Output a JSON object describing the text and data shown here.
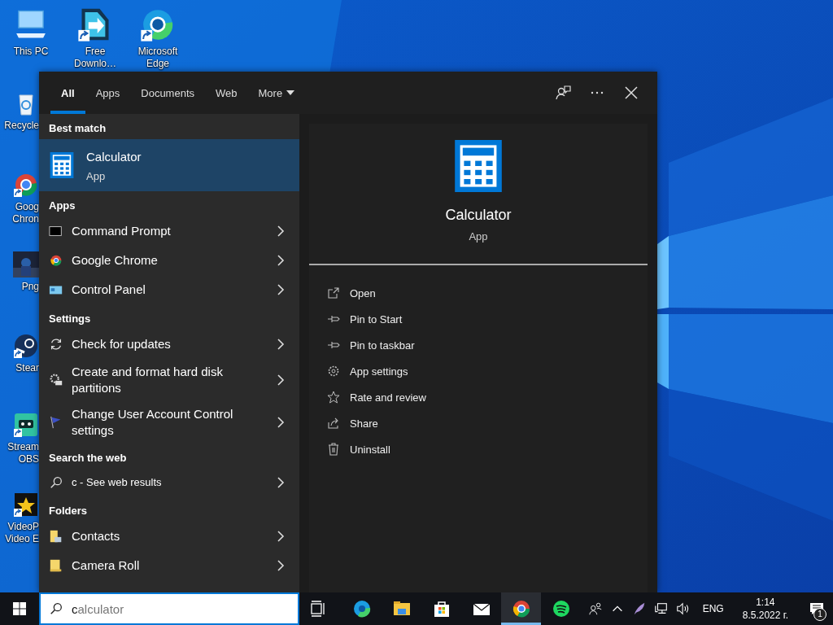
{
  "desktop": {
    "icons": [
      {
        "kind": "pc",
        "label": "This PC",
        "shortcut": false
      },
      {
        "kind": "download",
        "label": "Free Downlo…",
        "shortcut": true
      },
      {
        "kind": "edge",
        "label": "Microsoft Edge",
        "shortcut": true
      },
      {
        "kind": "recycle",
        "label": "Recycle",
        "shortcut": false
      },
      {
        "kind": "chrome",
        "label": "Goog Chron",
        "shortcut": true
      },
      {
        "label": "Png",
        "shortcut": false
      },
      {
        "kind": "steam",
        "label": "Stear",
        "shortcut": true
      },
      {
        "kind": "streamlabs",
        "label": "Stream OBS",
        "shortcut": true
      },
      {
        "kind": "video",
        "label": "VideoP Video E",
        "shortcut": true
      }
    ]
  },
  "search_panel": {
    "tabs": [
      {
        "label": "All",
        "selected": true
      },
      {
        "label": "Apps",
        "selected": false
      },
      {
        "label": "Documents",
        "selected": false
      },
      {
        "label": "Web",
        "selected": false
      },
      {
        "label": "More",
        "selected": false,
        "dropdown": true
      }
    ],
    "results": [
      {
        "kind": "header",
        "label": "Best match"
      },
      {
        "kind": "best",
        "title": "Calculator",
        "subtitle": "App",
        "selected": true
      },
      {
        "kind": "header",
        "label": "Apps"
      },
      {
        "kind": "item",
        "title": "Command Prompt",
        "selected": false
      },
      {
        "kind": "item",
        "title": "Google Chrome",
        "selected": false
      },
      {
        "kind": "item",
        "title": "Control Panel",
        "selected": false
      },
      {
        "kind": "header",
        "label": "Settings"
      },
      {
        "kind": "item",
        "title": "Check for updates",
        "selected": false
      },
      {
        "kind": "item",
        "title": "Create and format hard disk partitions",
        "selected": false
      },
      {
        "kind": "item",
        "title": "Change User Account Control settings",
        "selected": false
      },
      {
        "kind": "header",
        "label": "Search the web"
      },
      {
        "kind": "web",
        "title": "c - See web results",
        "selected": false
      },
      {
        "kind": "header",
        "label": "Folders"
      },
      {
        "kind": "item",
        "title": "Contacts",
        "selected": false
      },
      {
        "kind": "item",
        "title": "Camera Roll",
        "selected": false
      }
    ],
    "detail": {
      "title": "Calculator",
      "subtitle": "App",
      "actions": [
        {
          "label": "Open"
        },
        {
          "label": "Pin to Start"
        },
        {
          "label": "Pin to taskbar"
        },
        {
          "label": "App settings"
        },
        {
          "label": "Rate and review"
        },
        {
          "label": "Share"
        },
        {
          "label": "Uninstall"
        }
      ]
    }
  },
  "taskbar": {
    "search": {
      "value": "c",
      "autocomplete": "alculator"
    },
    "apps": [
      {
        "kind": "taskview",
        "active": false
      },
      {
        "kind": "edge",
        "active": false
      },
      {
        "kind": "explorer",
        "active": false
      },
      {
        "kind": "store",
        "active": false
      },
      {
        "kind": "mail",
        "active": false
      },
      {
        "kind": "chrome",
        "active": true
      },
      {
        "kind": "spotify",
        "active": false
      }
    ],
    "language": "ENG",
    "time": "1:14",
    "date": "8.5.2022 г.",
    "notifications": "1"
  }
}
